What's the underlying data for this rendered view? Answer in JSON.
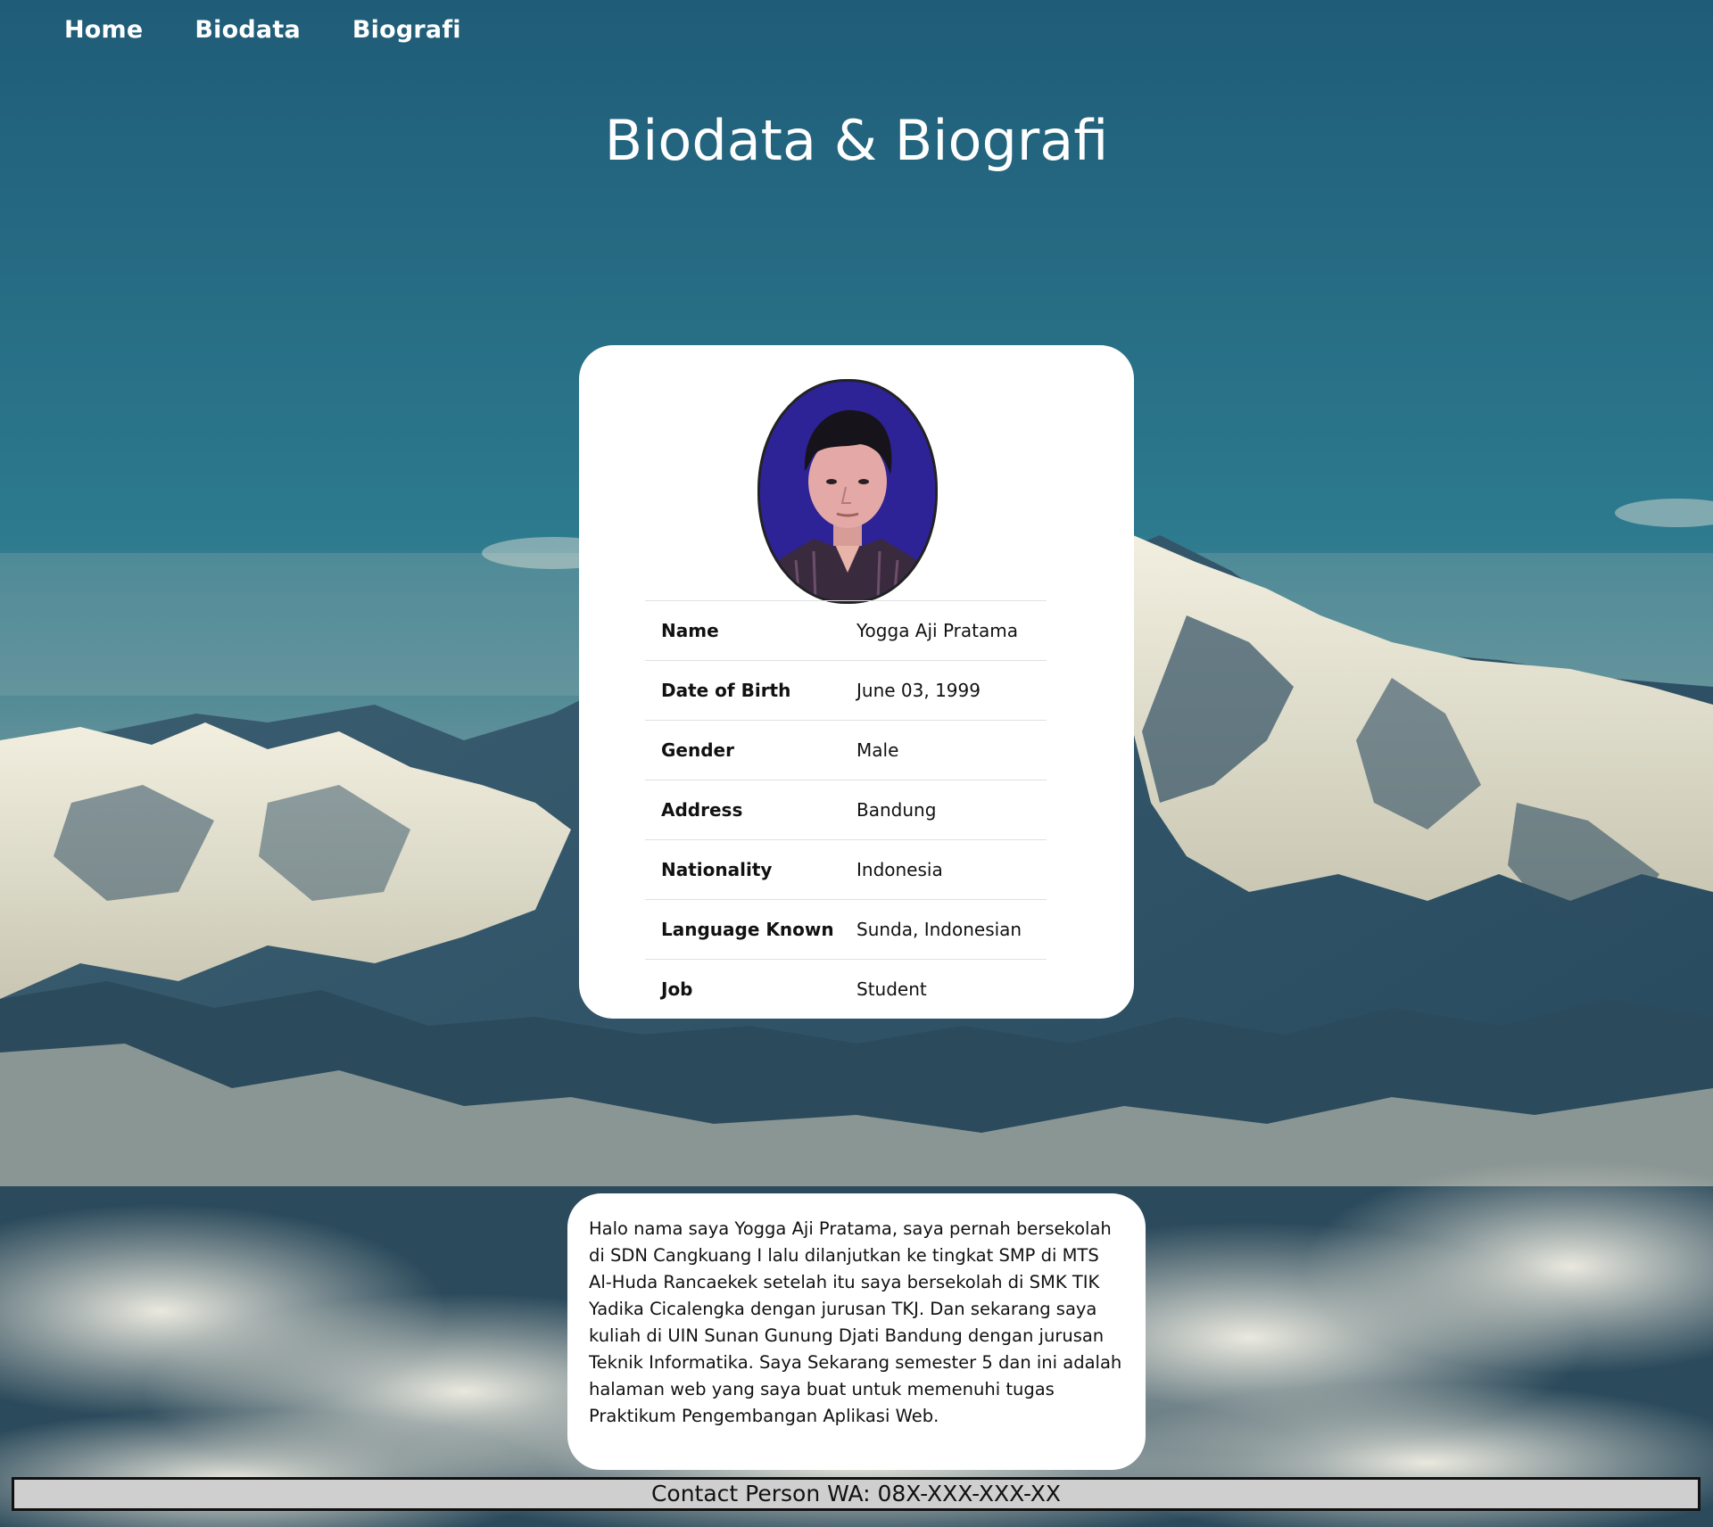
{
  "nav": {
    "items": [
      {
        "label": "Home"
      },
      {
        "label": "Biodata"
      },
      {
        "label": "Biografi"
      }
    ]
  },
  "header": {
    "title": "Biodata & Biografi"
  },
  "profile": {
    "rows": [
      {
        "key": "Name",
        "value": "Yogga Aji Pratama"
      },
      {
        "key": "Date of Birth",
        "value": "June 03, 1999"
      },
      {
        "key": "Gender",
        "value": "Male"
      },
      {
        "key": "Address",
        "value": "Bandung"
      },
      {
        "key": "Nationality",
        "value": "Indonesia"
      },
      {
        "key": "Language Known",
        "value": "Sunda, Indonesian"
      },
      {
        "key": "Job",
        "value": "Student"
      }
    ]
  },
  "biography": {
    "text": "Halo nama saya Yogga Aji Pratama, saya pernah bersekolah di SDN Cangkuang I lalu dilanjutkan ke tingkat SMP di MTS Al-Huda Rancaekek setelah itu saya bersekolah di SMK TIK Yadika Cicalengka dengan jurusan TKJ. Dan sekarang saya kuliah di UIN Sunan Gunung Djati Bandung dengan jurusan Teknik Informatika. Saya Sekarang semester 5 dan ini adalah halaman web yang saya buat untuk memenuhi tugas Praktikum Pengembangan Aplikasi Web."
  },
  "footer": {
    "contact": "Contact Person WA: 08X-XXX-XXX-XX"
  },
  "colors": {
    "sky_top": "#2b6d86",
    "card_bg": "#ffffff",
    "footer_bg": "#cfcfcf",
    "photo_bg": "#2d2296"
  }
}
